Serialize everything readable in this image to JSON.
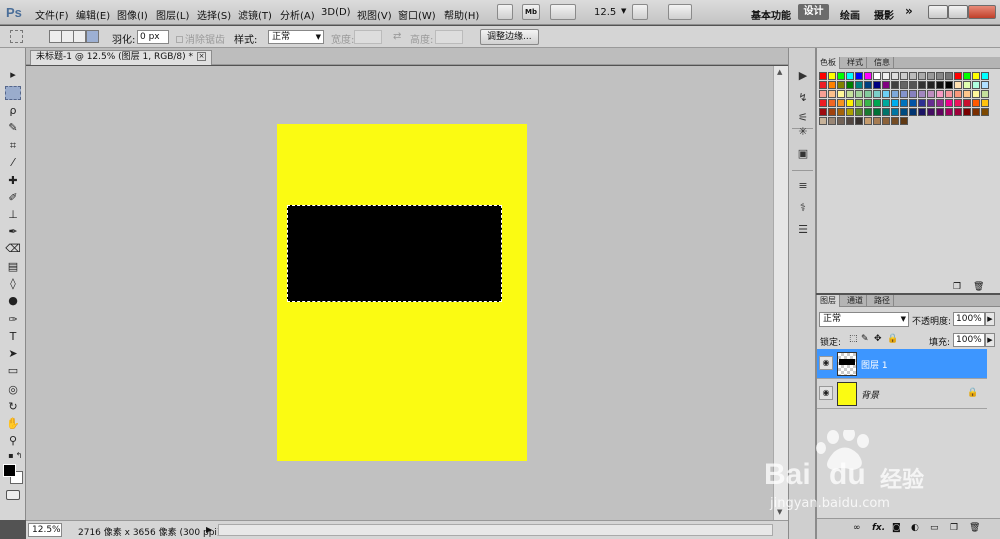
{
  "app": {
    "logo": "Ps"
  },
  "menu": [
    "文件(F)",
    "编辑(E)",
    "图像(I)",
    "图层(L)",
    "选择(S)",
    "滤镜(T)",
    "分析(A)",
    "3D(D)",
    "视图(V)",
    "窗口(W)",
    "帮助(H)"
  ],
  "top_toolbar": {
    "mb_label": "Mb",
    "zoom": "12.5"
  },
  "workspaces": {
    "basic": "基本功能",
    "active": "设计",
    "paint": "绘画",
    "photo": "摄影",
    "more": "»"
  },
  "options": {
    "feather_label": "羽化:",
    "feather_value": "0 px",
    "antialias_label": "消除锯齿",
    "style_label": "样式:",
    "style_value": "正常",
    "width_label": "宽度:",
    "height_label": "高度:",
    "refine_button": "调整边缘..."
  },
  "document": {
    "tab_title": "未标题-1 @ 12.5% (图层 1, RGB/8) *",
    "close": "×",
    "canvas_color": "#fbfb12",
    "selection_fill": "#000000"
  },
  "status": {
    "zoom": "12.5%",
    "info": "2716 像素 x 3656 像素 (300 ppi)"
  },
  "swatches_panel": {
    "tabs": [
      "色板",
      "样式",
      "信息"
    ],
    "active_tab": 0,
    "colors": [
      "#ff0000",
      "#ffff00",
      "#00ff00",
      "#00ffff",
      "#0000ff",
      "#ff00ff",
      "#ffffff",
      "#eeeeee",
      "#dddddd",
      "#cccccc",
      "#bbbbbb",
      "#aaaaaa",
      "#999999",
      "#888888",
      "#777777",
      "#ff0000",
      "#00ff00",
      "#ffff00",
      "#00ffff",
      "#ed1c24",
      "#ff8000",
      "#808000",
      "#008000",
      "#008080",
      "#004080",
      "#000080",
      "#800080",
      "#404040",
      "#666666",
      "#555555",
      "#333333",
      "#222222",
      "#111111",
      "#000000",
      "#ffe0b0",
      "#e0ffb0",
      "#b0ffe0",
      "#b0e0ff",
      "#f79f94",
      "#fbc08b",
      "#fff799",
      "#c4df9b",
      "#a3d39c",
      "#82ca9d",
      "#7bcdc8",
      "#6dcff6",
      "#7da7d9",
      "#8393ca",
      "#8781bd",
      "#a187be",
      "#bc8dbf",
      "#f49ac2",
      "#f6989d",
      "#f7977a",
      "#fdc68a",
      "#fff79a",
      "#c4df9b",
      "#ed1c24",
      "#f26522",
      "#f7941d",
      "#fff200",
      "#8dc63f",
      "#39b54a",
      "#00a651",
      "#00a99d",
      "#00aeef",
      "#0072bc",
      "#0054a6",
      "#2e3192",
      "#662d91",
      "#92278f",
      "#ec008c",
      "#ed145b",
      "#c8102e",
      "#ff5a00",
      "#ffc20e",
      "#9e0b0f",
      "#a0410d",
      "#a36209",
      "#aba000",
      "#598527",
      "#197b30",
      "#007236",
      "#00746b",
      "#0076a3",
      "#004b80",
      "#003471",
      "#1b1464",
      "#440e62",
      "#630460",
      "#9e005d",
      "#9e0039",
      "#790000",
      "#7b2e00",
      "#7d4900",
      "#c7b299",
      "#998675",
      "#736357",
      "#534741",
      "#37302d",
      "#c69c6d",
      "#a67c52",
      "#8c6239",
      "#754c24",
      "#603913"
    ]
  },
  "layers_panel": {
    "tabs": [
      "图层",
      "通道",
      "路径"
    ],
    "active_tab": 0,
    "blend_mode": "正常",
    "opacity_label": "不透明度:",
    "opacity_value": "100%",
    "lock_label": "锁定:",
    "fill_label": "填充:",
    "fill_value": "100%",
    "layers": [
      {
        "name": "图层 1",
        "selected": true
      },
      {
        "name": "背景",
        "selected": false
      }
    ],
    "footer_icons": [
      "link-icon",
      "fx-icon",
      "mask-icon",
      "adjustment-icon",
      "group-icon",
      "new-layer-icon",
      "trash-icon"
    ],
    "fx_label": "fx."
  },
  "watermark": {
    "brand": "Bai",
    "suffix": "du",
    "cn": "经验",
    "url": "jingyan.baidu.com"
  }
}
